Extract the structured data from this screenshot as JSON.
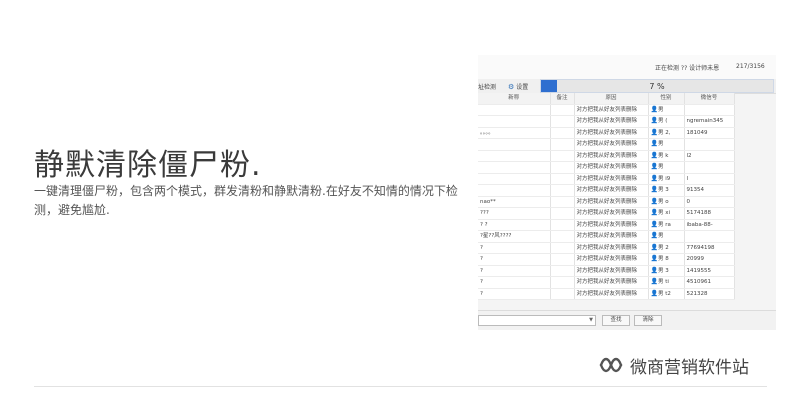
{
  "promo": {
    "title": "静默清除僵尸粉.",
    "description": "一键清理僵尸粉，包含两个模式，群发清粉和静默清粉.在好友不知情的情况下检测，避免尴尬."
  },
  "watermark": {
    "text": "微商营销软件站",
    "icon": "wechat-channel-logo"
  },
  "app": {
    "status": "正在检测 ?? 设计师未恩",
    "count": "217/3156",
    "toolbar": {
      "detect_label": "址检测",
      "settings_icon": "gear-icon",
      "settings_label": "设置"
    },
    "progress": {
      "percent": 7,
      "label": "7 %"
    },
    "columns": [
      "新称",
      "备注",
      "原因",
      "性别",
      "微信号"
    ],
    "rows": [
      {
        "nick": "",
        "note": "",
        "reason": "对方把我从好友列表删除",
        "gender": "男",
        "wxid": ""
      },
      {
        "nick": "",
        "note": "",
        "reason": "对方把我从好友列表删除",
        "gender": "男 (",
        "wxid": "ngremain345"
      },
      {
        "nick": "。。。。",
        "note": "",
        "reason": "对方把我从好友列表删除",
        "gender": "男 2,",
        "wxid": "181049"
      },
      {
        "nick": "",
        "note": "",
        "reason": "对方把我从好友列表删除",
        "gender": "男",
        "wxid": ""
      },
      {
        "nick": "",
        "note": "",
        "reason": "对方把我从好友列表删除",
        "gender": "男 k",
        "wxid": "l2"
      },
      {
        "nick": "",
        "note": "",
        "reason": "对方把我从好友列表删除",
        "gender": "男",
        "wxid": ""
      },
      {
        "nick": "",
        "note": "",
        "reason": "对方把我从好友列表删除",
        "gender": "男 i9",
        "wxid": "l"
      },
      {
        "nick": "",
        "note": "",
        "reason": "对方把我从好友列表删除",
        "gender": "男 3",
        "wxid": "91354"
      },
      {
        "nick": "nao**",
        "note": "",
        "reason": "对方把我从好友列表删除",
        "gender": "男 o",
        "wxid": "0"
      },
      {
        "nick": "???",
        "note": "",
        "reason": "对方把我从好友列表删除",
        "gender": "男 xi",
        "wxid": "5174188"
      },
      {
        "nick": "? ?",
        "note": "",
        "reason": "对方把我从好友列表删除",
        "gender": "男 ra",
        "wxid": "ibaba-88-"
      },
      {
        "nick": "?星??风????",
        "note": "",
        "reason": "对方把我从好友列表删除",
        "gender": "男",
        "wxid": ""
      },
      {
        "nick": "?",
        "note": "",
        "reason": "对方把我从好友列表删除",
        "gender": "男 2",
        "wxid": "77694198"
      },
      {
        "nick": "?",
        "note": "",
        "reason": "对方把我从好友列表删除",
        "gender": "男 8",
        "wxid": "20999"
      },
      {
        "nick": "?",
        "note": "",
        "reason": "对方把我从好友列表删除",
        "gender": "男 3",
        "wxid": "1419555"
      },
      {
        "nick": "?",
        "note": "",
        "reason": "对方把我从好友列表删除",
        "gender": "男 ti",
        "wxid": "4510961"
      },
      {
        "nick": "?",
        "note": "",
        "reason": "对方把我从好友列表删除",
        "gender": "男 t2",
        "wxid": "521328"
      }
    ],
    "bottom": {
      "combo_value": "",
      "search_label": "查找",
      "clear_label": "清除"
    }
  }
}
